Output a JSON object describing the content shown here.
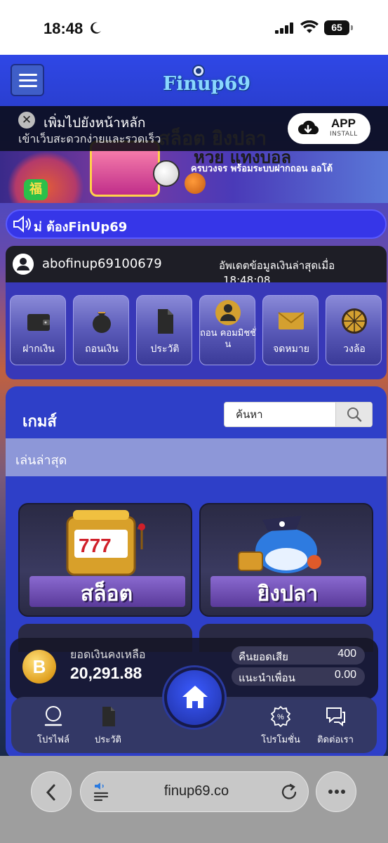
{
  "status_bar": {
    "time": "18:48",
    "battery": "65"
  },
  "header": {
    "logo_text": "Finup69"
  },
  "install_prompt": {
    "title": "เพิ่มไปยังหน้าหลัก",
    "subtitle": "เข้าเว็บสะดวกง่ายและรวดเร็ว",
    "app_label": "APP",
    "install_label": "INSTALL"
  },
  "banner": {
    "headline": "สล็อต ยิงปลา",
    "headline2": "หวย แทงบอล",
    "sub": "ครบวงจร พร้อมระบบฝากถอน ออโต้",
    "badge": "福"
  },
  "marquee": {
    "text": "ม่ ต้องFinUp69"
  },
  "user": {
    "username": "abofinup69100679",
    "update_label": "อัพเดตข้อมูลเงินล่าสุดเมื่อ",
    "update_time": "18:48:08"
  },
  "quick_menu": [
    {
      "label": "ฝากเงิน",
      "icon": "wallet-icon"
    },
    {
      "label": "ถอนเงิน",
      "icon": "money-bag-icon"
    },
    {
      "label": "ประวัติ",
      "icon": "document-icon"
    },
    {
      "label": "ถอน คอมมิชชั่ น",
      "icon": "commission-icon"
    },
    {
      "label": "จดหมาย",
      "icon": "envelope-icon"
    },
    {
      "label": "วงล้อ",
      "icon": "wheel-icon"
    }
  ],
  "games": {
    "title": "เกมส์",
    "search_placeholder": "ค้นหา",
    "recent_label": "เล่นล่าสุด",
    "cards": [
      {
        "label": "สล็อต",
        "icon": "slot-machine-icon"
      },
      {
        "label": "ยิงปลา",
        "icon": "shark-icon"
      }
    ]
  },
  "balance": {
    "label": "ยอดเงินคงเหลือ",
    "value": "20,291.88",
    "coin_symbol": "B",
    "stats": [
      {
        "label": "คืนยอดเสีย",
        "value": "400"
      },
      {
        "label": "แนะนำเพื่อน",
        "value": "0.00"
      }
    ]
  },
  "bottom_nav": {
    "items": [
      {
        "label": "โปรไฟล์",
        "icon": "profile-icon"
      },
      {
        "label": "ประวัติ",
        "icon": "history-icon"
      },
      {
        "label": "โปรโมชั่น",
        "icon": "promotion-icon"
      },
      {
        "label": "ติดต่อเรา",
        "icon": "chat-icon"
      }
    ],
    "home_icon": "home-icon"
  },
  "browser": {
    "url": "finup69.co"
  },
  "colors": {
    "header_blue": "#2f47e6",
    "panel_blue": "#2e3fc8",
    "marquee_blue": "#3636e8"
  }
}
